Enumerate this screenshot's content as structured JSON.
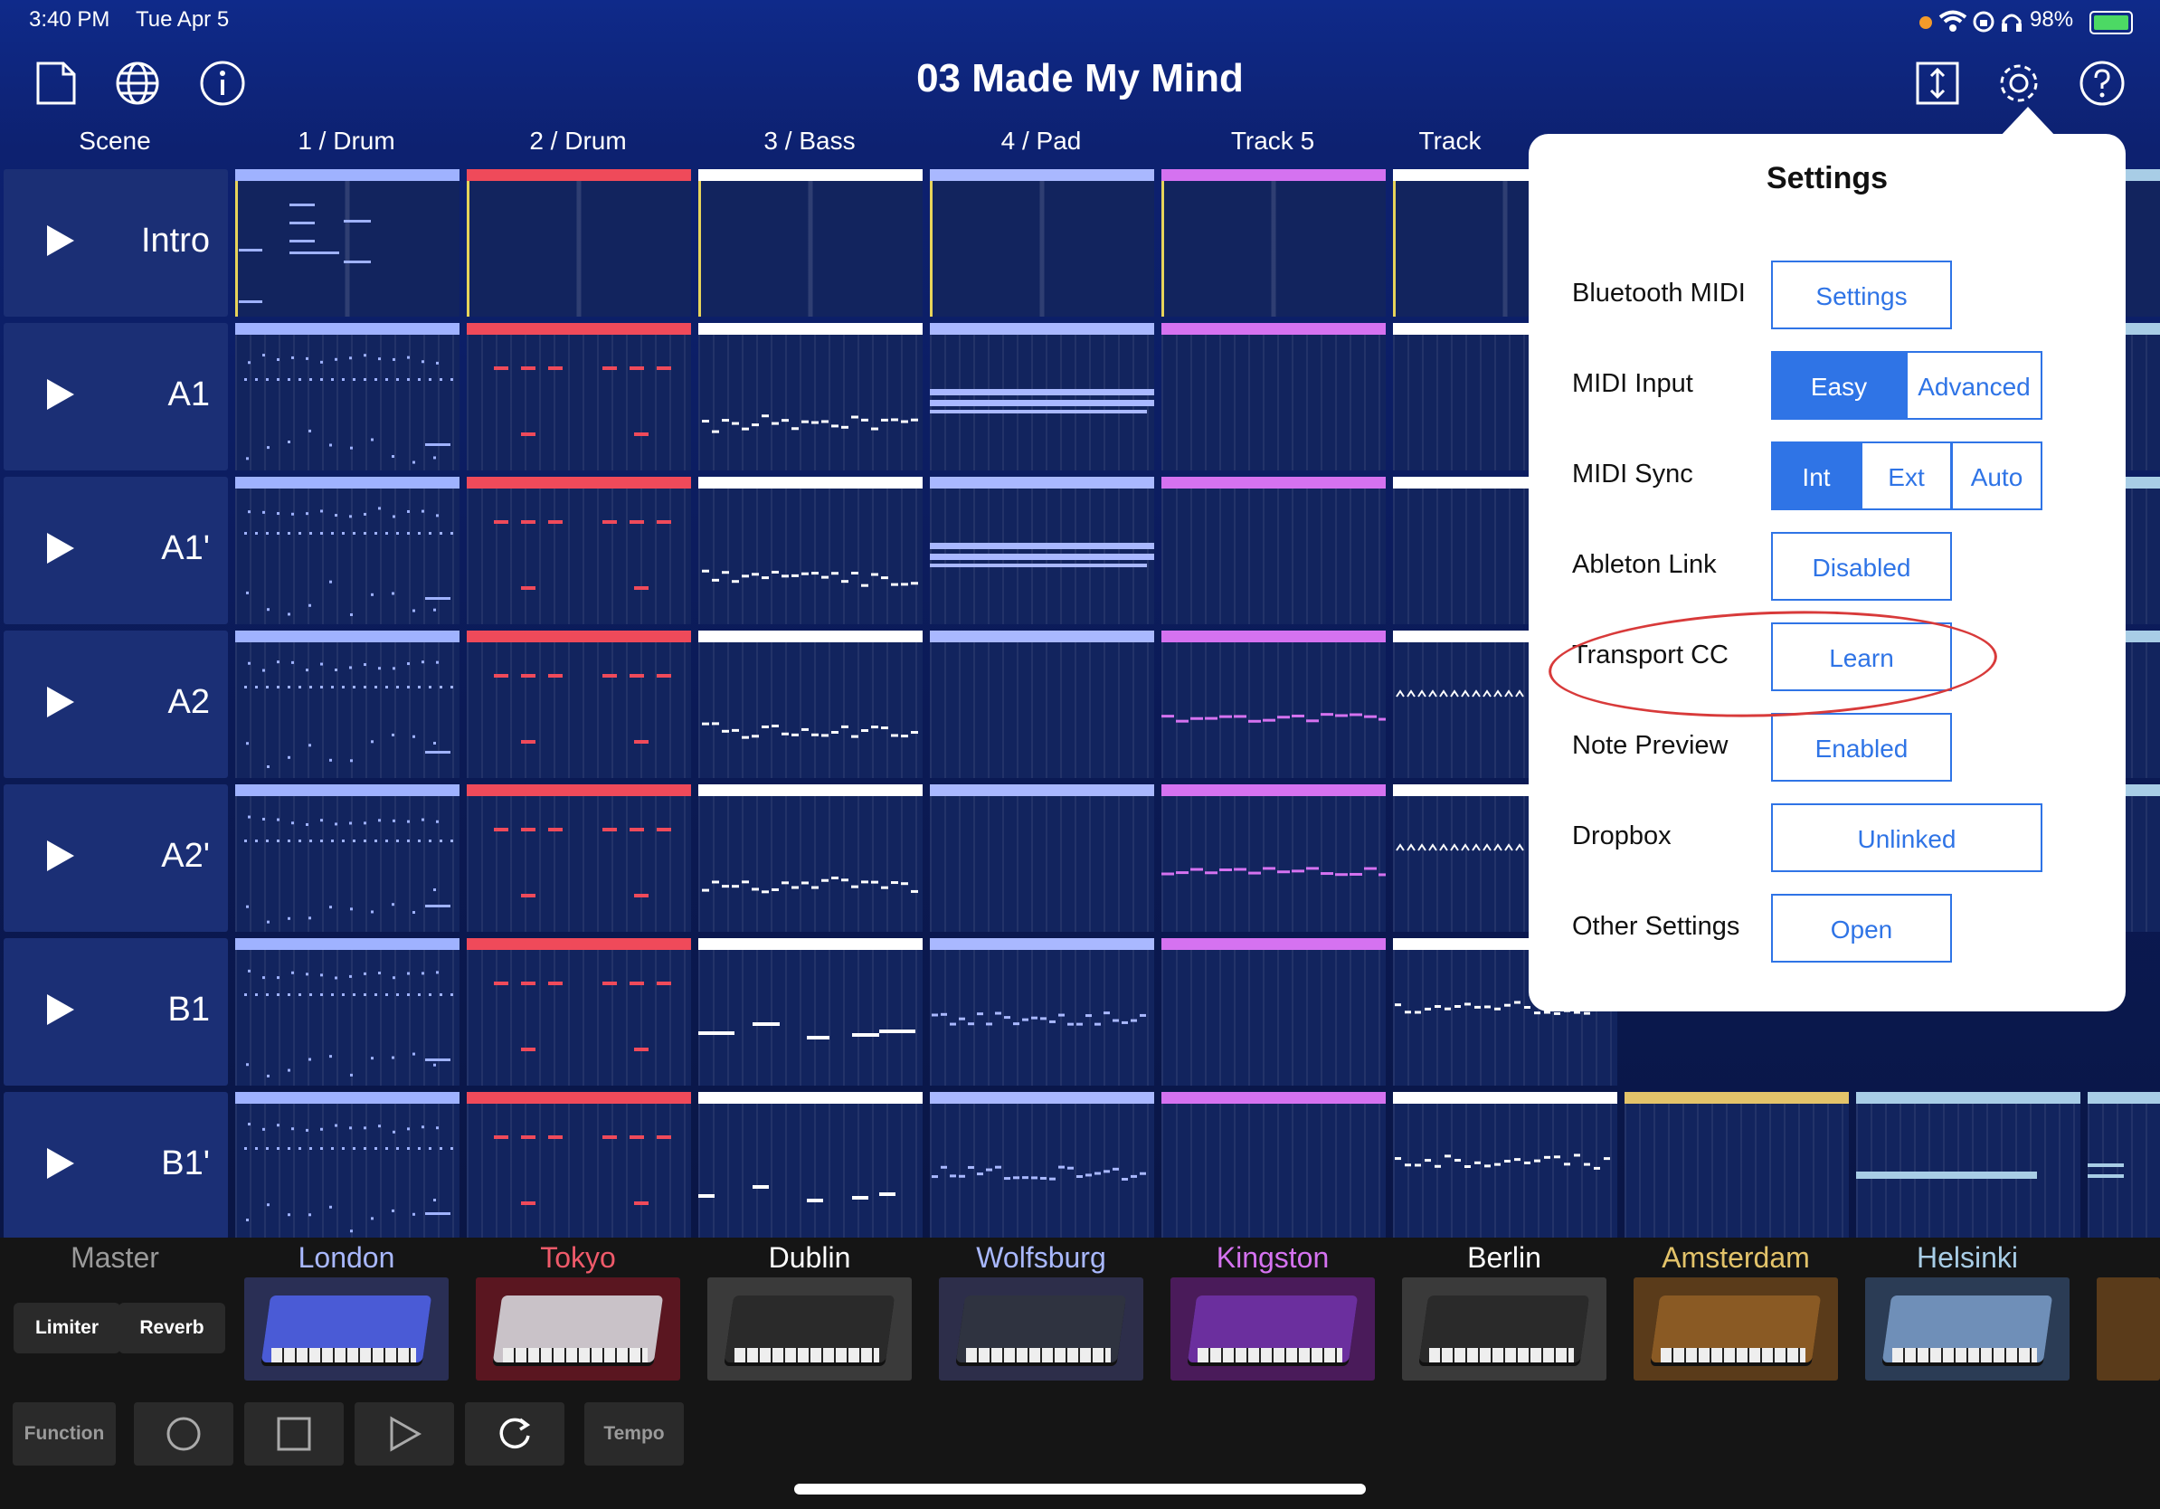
{
  "status": {
    "time": "3:40 PM",
    "date": "Tue Apr 5",
    "battery": "98%"
  },
  "toolbar": {
    "title": "03 Made My Mind",
    "icons": [
      "document-icon",
      "globe-icon",
      "info-icon",
      "resize-icon",
      "gear-icon",
      "help-icon"
    ]
  },
  "columns": [
    "Scene",
    "1 / Drum",
    "2 / Drum",
    "3 / Bass",
    "4 / Pad",
    "Track 5",
    "Track"
  ],
  "scenes": [
    "Intro",
    "A1",
    "A1'",
    "A2",
    "A2'",
    "B1",
    "B1'"
  ],
  "track_colors": [
    "#9fb2ff",
    "#ef4a5a",
    "#ffffff",
    "#a9b8ff",
    "#d572f0",
    "#ffffff",
    "#e3c36a",
    "#a8cde6"
  ],
  "settings": {
    "title": "Settings",
    "rows": [
      {
        "label": "Bluetooth MIDI",
        "buttons": [
          "Settings"
        ],
        "selected": -1
      },
      {
        "label": "MIDI Input",
        "buttons": [
          "Easy",
          "Advanced"
        ],
        "selected": 0
      },
      {
        "label": "MIDI Sync",
        "buttons": [
          "Int",
          "Ext",
          "Auto"
        ],
        "selected": 0
      },
      {
        "label": "Ableton Link",
        "buttons": [
          "Disabled"
        ],
        "selected": -1
      },
      {
        "label": "Transport CC",
        "buttons": [
          "Learn"
        ],
        "selected": -1
      },
      {
        "label": "Note Preview",
        "buttons": [
          "Enabled"
        ],
        "selected": -1
      },
      {
        "label": "Dropbox",
        "buttons": [
          "Unlinked"
        ],
        "selected": -1
      },
      {
        "label": "Other Settings",
        "buttons": [
          "Open"
        ],
        "selected": -1
      }
    ]
  },
  "instruments": [
    {
      "name": "Master",
      "color": "#9a9a9a"
    },
    {
      "name": "London",
      "color": "#a9b8ff"
    },
    {
      "name": "Tokyo",
      "color": "#ef5a6a"
    },
    {
      "name": "Dublin",
      "color": "#ffffff"
    },
    {
      "name": "Wolfsburg",
      "color": "#a9b8ff"
    },
    {
      "name": "Kingston",
      "color": "#d572f0"
    },
    {
      "name": "Berlin",
      "color": "#ffffff"
    },
    {
      "name": "Amsterdam",
      "color": "#e3c36a"
    },
    {
      "name": "Helsinki",
      "color": "#a8cde6"
    }
  ],
  "master_fx": [
    "Limiter",
    "Reverb"
  ],
  "transport": {
    "function_label": "Function",
    "tempo_label": "Tempo"
  }
}
